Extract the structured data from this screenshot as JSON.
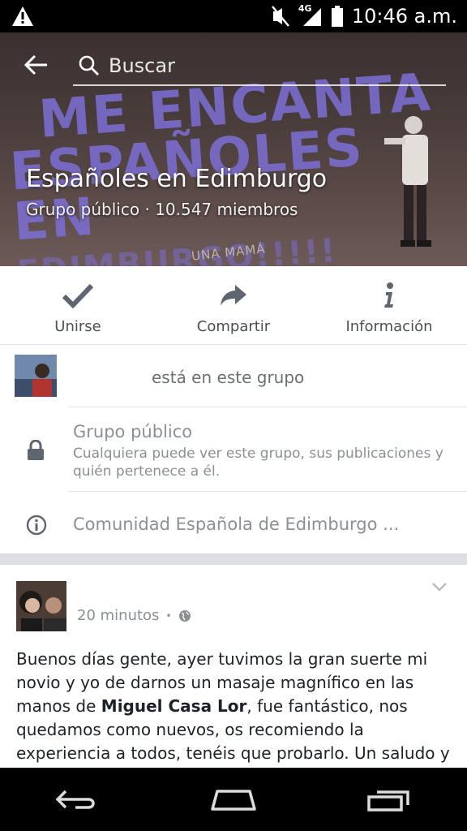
{
  "status_bar": {
    "network": "4G",
    "time": "10:46 a.m.",
    "icons": [
      "warning-icon",
      "mute-icon",
      "signal-icon",
      "battery-icon"
    ]
  },
  "header": {
    "search_placeholder": "Buscar",
    "cover_graffiti": [
      "ME ENCANTA",
      "ESPAÑOLES EN",
      "EDIMBURGO!!!!!"
    ],
    "cover_caption": "UNA MAMÁ",
    "group_name": "Españoles en Edimburgo",
    "group_meta": "Grupo público · 10.547 miembros"
  },
  "actions": [
    {
      "label": "Unirse",
      "icon": "check-icon"
    },
    {
      "label": "Compartir",
      "icon": "share-icon"
    },
    {
      "label": "Información",
      "icon": "info-icon"
    }
  ],
  "member_row": {
    "text": "está en este grupo"
  },
  "privacy": {
    "title": "Grupo público",
    "description": "Cualquiera puede ver este grupo, sus publicaciones y quién pertenece a él."
  },
  "community": {
    "text": "Comunidad Española de Edimburgo ..."
  },
  "post": {
    "time": "20 minutos",
    "separator": "•",
    "body_before": "Buenos días gente, ayer tuvimos la gran suerte mi novio y yo de darnos un masaje magnífico en las manos de ",
    "body_bold": "Miguel Casa Lor",
    "body_after": ", fue fantástico, nos quedamos como nuevos, os recomiendo la experiencia a todos, tenéis que probarlo.  Un saludo y"
  },
  "colors": {
    "icon_gray": "#5f6670",
    "text_gray": "#8b8f96",
    "separator": "#dcdee1"
  }
}
